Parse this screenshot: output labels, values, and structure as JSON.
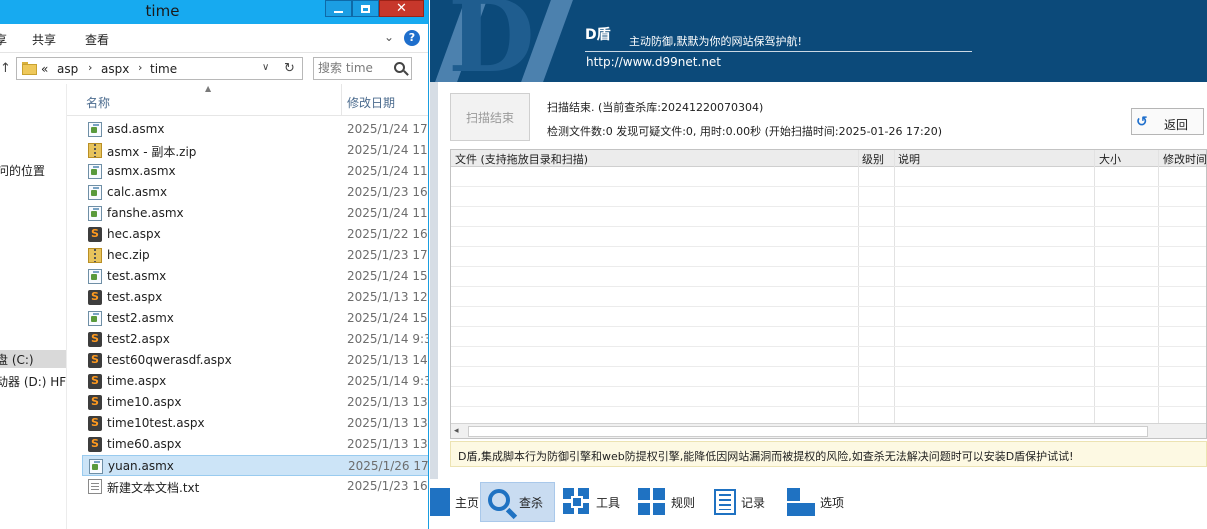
{
  "explorer": {
    "title": "time",
    "ribbon_tabs": [
      "享",
      "共享",
      "查看"
    ],
    "address": {
      "overflow": "«",
      "crumbs": [
        "asp",
        "aspx",
        "time"
      ]
    },
    "search_placeholder": "搜索 time",
    "nav": {
      "item_location": "问的位置",
      "item_c": "盘 (C:)",
      "item_d": "动器 (D:) HF"
    },
    "columns": {
      "name": "名称",
      "date": "修改日期"
    },
    "files": [
      {
        "name": "asd.asmx",
        "date": "2025/1/24 17",
        "type": "asmx"
      },
      {
        "name": "asmx - 副本.zip",
        "date": "2025/1/24 11",
        "type": "zip"
      },
      {
        "name": "asmx.asmx",
        "date": "2025/1/24 11",
        "type": "asmx"
      },
      {
        "name": "calc.asmx",
        "date": "2025/1/23 16",
        "type": "asmx"
      },
      {
        "name": "fanshe.asmx",
        "date": "2025/1/24 11",
        "type": "asmx"
      },
      {
        "name": "hec.aspx",
        "date": "2025/1/22 16",
        "type": "aspx"
      },
      {
        "name": "hec.zip",
        "date": "2025/1/23 17",
        "type": "zip"
      },
      {
        "name": "test.asmx",
        "date": "2025/1/24 15",
        "type": "asmx"
      },
      {
        "name": "test.aspx",
        "date": "2025/1/13 12",
        "type": "aspx"
      },
      {
        "name": "test2.asmx",
        "date": "2025/1/24 15",
        "type": "asmx"
      },
      {
        "name": "test2.aspx",
        "date": "2025/1/14 9:3",
        "type": "aspx"
      },
      {
        "name": "test60qwerasdf.aspx",
        "date": "2025/1/13 14",
        "type": "aspx"
      },
      {
        "name": "time.aspx",
        "date": "2025/1/14 9:3",
        "type": "aspx"
      },
      {
        "name": "time10.aspx",
        "date": "2025/1/13 13",
        "type": "aspx"
      },
      {
        "name": "time10test.aspx",
        "date": "2025/1/13 13",
        "type": "aspx"
      },
      {
        "name": "time60.aspx",
        "date": "2025/1/13 13",
        "type": "aspx"
      },
      {
        "name": "yuan.asmx",
        "date": "2025/1/26 17",
        "type": "asmx",
        "selected": true
      },
      {
        "name": "新建文本文档.txt",
        "date": "2025/1/23 16",
        "type": "txt"
      }
    ]
  },
  "dshield": {
    "logo": "D",
    "brand": "D盾",
    "slogan": "主动防御,默默为你的网站保驾护航!",
    "url": "http://www.d99net.net",
    "scan_button": "扫描结束",
    "status_line1": "扫描结束. (当前查杀库:20241220070304)",
    "status_line2": "检测文件数:0 发现可疑文件:0, 用时:0.00秒 (开始扫描时间:2025-01-26 17:20)",
    "back_button": "返回",
    "table_headers": {
      "file": "文件 (支持拖放目录和扫描)",
      "level": "级别",
      "desc": "说明",
      "size": "大小",
      "mtime": "修改时间"
    },
    "notice": "D盾,集成脚本行为防御引擎和web防提权引擎,能降低因网站漏洞而被提权的风险,如查杀无法解决问题时可以安装D盾保护试试!",
    "toolbar": {
      "home": "主页",
      "scan": "查杀",
      "tools": "工具",
      "rules": "规则",
      "log": "记录",
      "options": "选项"
    },
    "colors": {
      "banner": "#0c4a7a",
      "accent": "#1f72c2",
      "notice_bg": "#fdf9e3"
    }
  }
}
